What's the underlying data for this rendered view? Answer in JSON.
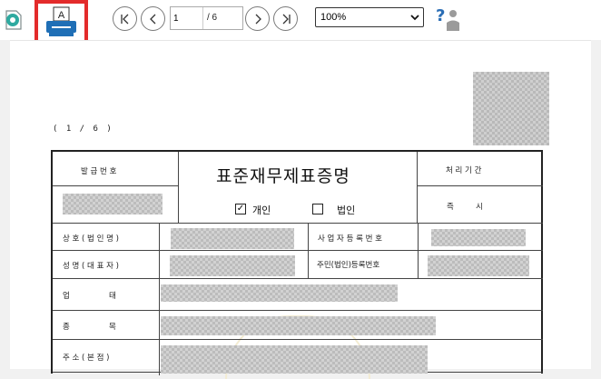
{
  "toolbar": {
    "document_icon": "document-view-icon",
    "print_icon": "printer-icon",
    "print_label": "A",
    "first_label": "|<",
    "prev_label": "<",
    "next_label": ">",
    "last_label": ">|",
    "page_current": "1",
    "page_total": "/ 6",
    "zoom_value": "100%",
    "zoom_arrow": "⌄",
    "help_icon": "help-icon",
    "colors": {
      "highlight": "#e32b2b",
      "print_blue": "#1f6fb6",
      "help_blue": "#2a6db5"
    }
  },
  "document": {
    "page_indicator": "( 1 / 6 )",
    "title": "표준재무제표증명",
    "issue_no_label": "발 급 번 호",
    "processing_period_label": "처 리 기 간",
    "immediate_label": "즉         시",
    "individual_label": "개인",
    "corporation_label": "법인",
    "individual_checked": "✓",
    "company_name_label": "상 호 ( 법 인 명 )",
    "business_reg_label": "사 업 자 등 록 번 호",
    "name_label": "성 명 ( 대 표 자 )",
    "resident_no_label": "주민(법인)등록번호",
    "business_type_label": "업                태",
    "business_item_label": "종                목",
    "address_label": "주 소 ( 본 점 )"
  }
}
